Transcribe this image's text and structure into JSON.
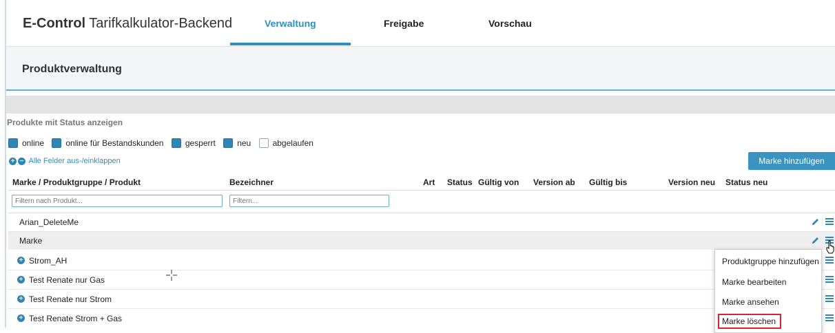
{
  "header": {
    "brand_bold": "E-Control",
    "brand_rest": " Tarifkalkulator-Backend",
    "tabs": [
      {
        "label": "Verwaltung",
        "active": true
      },
      {
        "label": "Freigabe",
        "active": false
      },
      {
        "label": "Vorschau",
        "active": false
      }
    ]
  },
  "page": {
    "title": "Produktverwaltung"
  },
  "status_filter": {
    "label": "Produkte mit Status anzeigen",
    "options": [
      {
        "label": "online",
        "checked": true
      },
      {
        "label": "online für Bestandskunden",
        "checked": true
      },
      {
        "label": "gesperrt",
        "checked": true
      },
      {
        "label": "neu",
        "checked": true
      },
      {
        "label": "abgelaufen",
        "checked": false
      }
    ]
  },
  "collapse_link": "Alle Felder aus-/einklappen",
  "add_brand_button": "Marke hinzufügen",
  "table": {
    "columns": [
      "Marke / Produktgruppe / Produkt",
      "Bezeichner",
      "Art",
      "Status",
      "Gültig von",
      "Version ab",
      "Gültig bis",
      "Version neu",
      "Status neu"
    ],
    "filter_product_placeholder": "Filtern nach Produkt...",
    "filter_id_placeholder": "Filtern...",
    "rows": [
      {
        "label": "Arian_DeleteMe"
      },
      {
        "label": "Marke"
      },
      {
        "label": "Strom_AH"
      },
      {
        "label": "Test Renate nur Gas"
      },
      {
        "label": "Test Renate nur Strom"
      },
      {
        "label": "Test Renate Strom + Gas"
      }
    ]
  },
  "context_menu": {
    "items": [
      "Produktgruppe hinzufügen",
      "Marke bearbeiten",
      "Marke ansehen",
      "Marke löschen"
    ]
  },
  "colors": {
    "accent": "#2e8fbd",
    "highlight": "#e0202b"
  }
}
